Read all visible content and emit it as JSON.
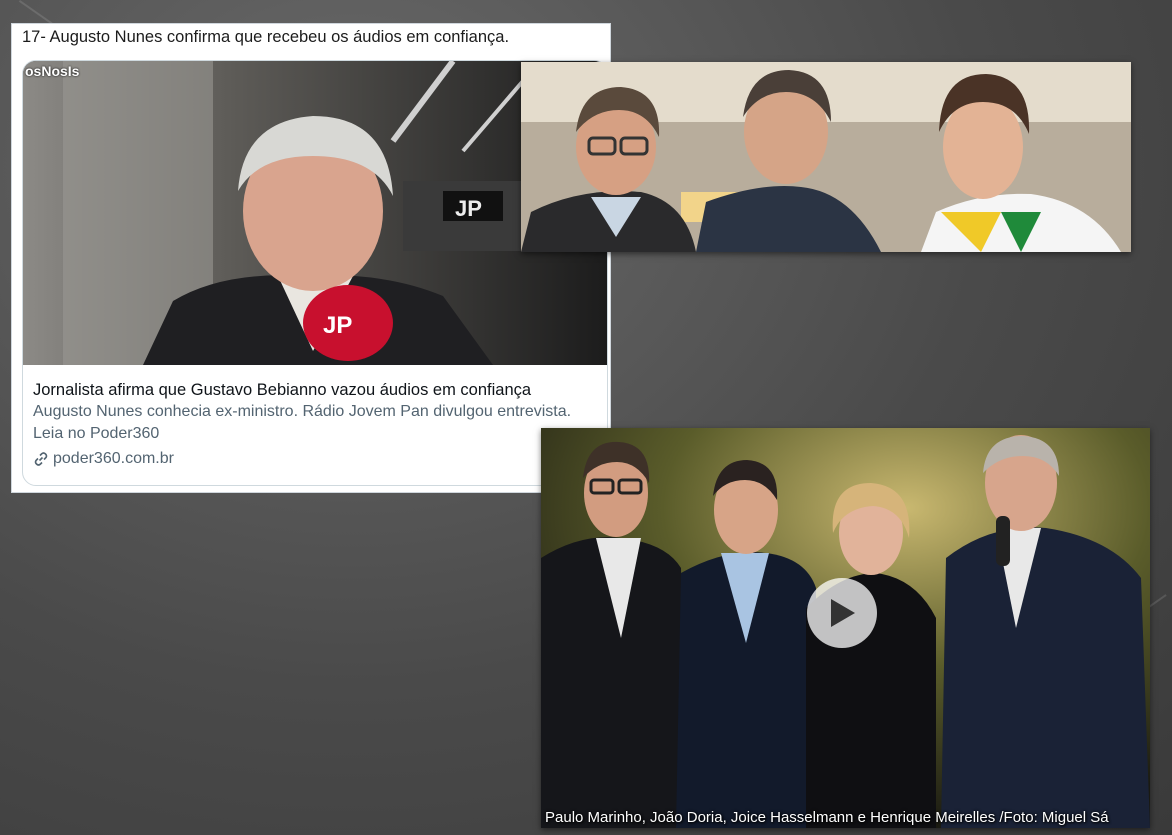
{
  "tweet": {
    "text": "17- Augusto Nunes confirma que recebeu os áudios em confiança.",
    "card": {
      "watermark": "osNosIs",
      "title": "Jornalista afirma que Gustavo Bebianno vazou áudios em confiança",
      "description": "Augusto Nunes conhecia ex-ministro. Rádio Jovem Pan divulgou entrevista. Leia no Poder360",
      "domain": "poder360.com.br"
    }
  },
  "photo_bottom": {
    "caption": "Paulo Marinho, João Doria, Joice Hasselmann e Henrique Meirelles /Foto: Miguel Sá"
  },
  "colors": {
    "link_gray": "#536471",
    "card_border": "#cfd9de",
    "background": "#4a4a4a"
  }
}
